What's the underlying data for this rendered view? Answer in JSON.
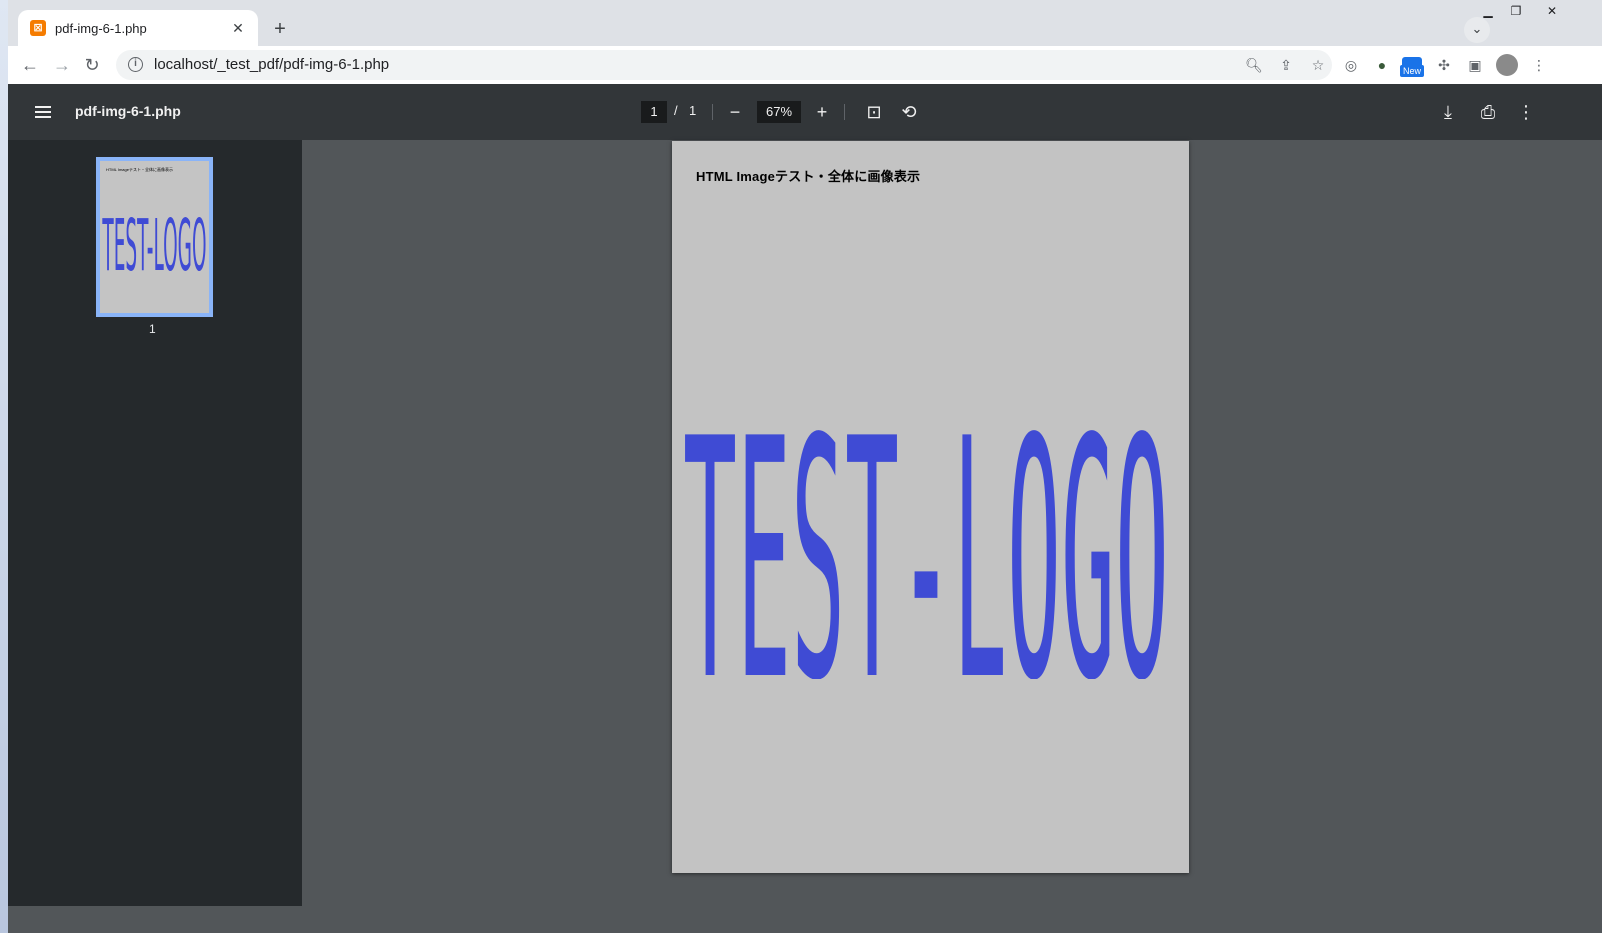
{
  "browser": {
    "tab_title": "pdf-img-6-1.php",
    "tab_favicon": "xampp-icon",
    "url": "localhost/_test_pdf/pdf-img-6-1.php",
    "new_badge_label": "New",
    "window_controls": [
      "minimize",
      "restore",
      "close"
    ]
  },
  "pdf": {
    "title": "pdf-img-6-1.php",
    "current_page": "1",
    "page_separator": "/",
    "total_pages": "1",
    "zoom": "67%",
    "thumbnail_label": "1",
    "page_heading": "HTML Imageテスト・全体に画像表示",
    "logo_text": "TEST-LOGO",
    "logo_color": "#3f4bd4",
    "page_background": "#c3c3c3"
  }
}
